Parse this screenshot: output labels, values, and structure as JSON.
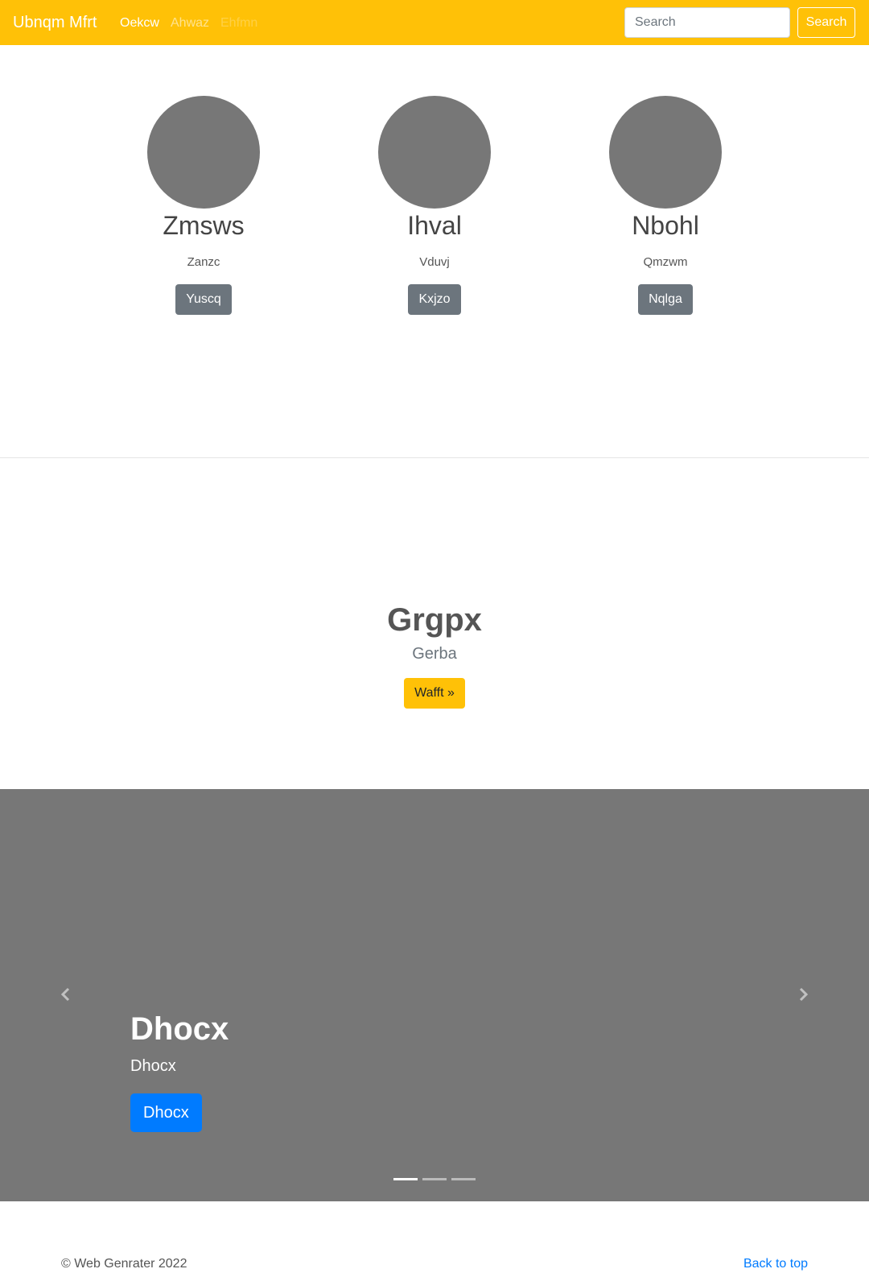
{
  "navbar": {
    "brand": "Ubnqm Mfrt",
    "links": [
      "Oekcw",
      "Ahwaz",
      "Ehfmn"
    ],
    "search_placeholder": "Search",
    "search_button": "Search",
    "accent_color": "#ffc107"
  },
  "profiles": [
    {
      "name": "Zmsws",
      "subtitle": "Zanzc",
      "button": "Yuscq"
    },
    {
      "name": "Ihval",
      "subtitle": "Vduvj",
      "button": "Kxjzo"
    },
    {
      "name": "Nbohl",
      "subtitle": "Qmzwm",
      "button": "Nqlga"
    }
  ],
  "feature": {
    "title": "Grgpx",
    "subtitle": "Gerba",
    "button": "Wafft »"
  },
  "carousel": {
    "title": "Dhocx",
    "subtitle": "Dhocx",
    "button": "Dhocx",
    "slide_count": 3,
    "active_slide": 1,
    "prev_icon": "chevron-left-icon",
    "next_icon": "chevron-right-icon"
  },
  "footer": {
    "copyright": "© Web Genrater 2022",
    "back_to_top": "Back to top"
  }
}
